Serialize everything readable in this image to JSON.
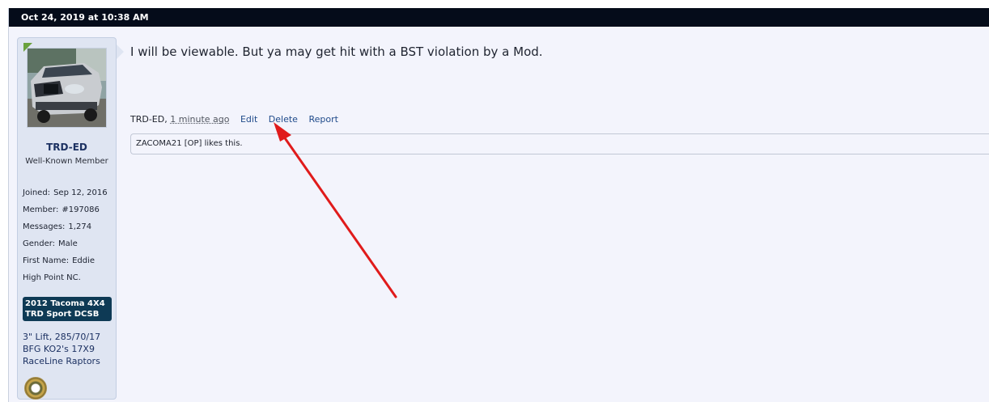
{
  "post": {
    "date": "Oct 24, 2019 at 10:38 AM",
    "message": "I will be viewable. But ya may get hit with a BST violation by a Mod.",
    "author": "TRD-ED",
    "time_ago": "1 minute ago",
    "actions": {
      "edit": "Edit",
      "delete": "Delete",
      "report": "Report"
    },
    "likes_text": "ZACOMA21 [OP] likes this."
  },
  "user": {
    "name": "TRD-ED",
    "title": "Well-Known Member",
    "stats": [
      {
        "label": "Joined:",
        "value": "Sep 12, 2016"
      },
      {
        "label": "Member:",
        "value": "#197086"
      },
      {
        "label": "Messages:",
        "value": "1,274"
      },
      {
        "label": "Gender:",
        "value": "Male"
      },
      {
        "label": "First Name:",
        "value": "Eddie"
      }
    ],
    "location": "High Point NC.",
    "vehicle_badge": {
      "line1": "2012 Tacoma 4X4",
      "line2": "TRD Sport DCSB"
    },
    "extras": [
      "3\" Lift, 285/70/17",
      "BFG KO2's 17X9",
      "RaceLine Raptors"
    ]
  },
  "colors": {
    "header_bg": "#050c1a",
    "sidebar_bg": "#dfe5f2",
    "badge_bg": "#0e3a55",
    "link": "#1f4a8a",
    "annotation_arrow": "#e01b1b"
  },
  "icons": {
    "avatar": "truck-avatar-image",
    "online_indicator": "online-flag-icon",
    "medal": "army-medal-icon",
    "annotation": "red-arrow-annotation"
  }
}
